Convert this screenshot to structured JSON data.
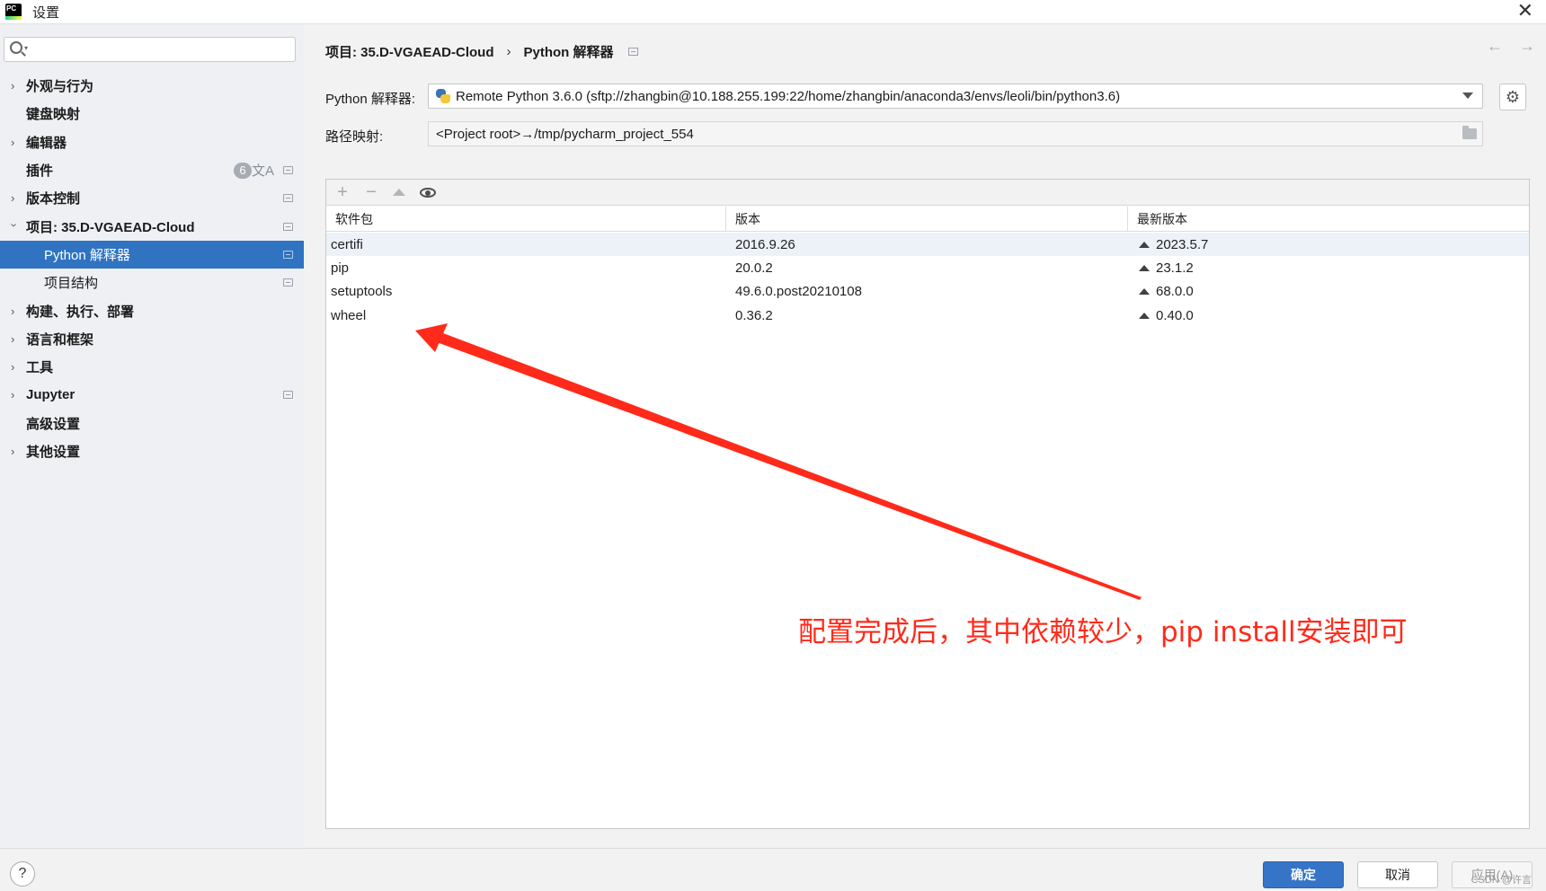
{
  "window": {
    "title": "设置",
    "app_icon_text": "PC"
  },
  "sidebar": {
    "search_placeholder": "",
    "items": [
      {
        "label": "外观与行为",
        "expandable": true
      },
      {
        "label": "键盘映射",
        "expandable": false
      },
      {
        "label": "编辑器",
        "expandable": true
      },
      {
        "label": "插件",
        "expandable": false,
        "badge": "6"
      },
      {
        "label": "版本控制",
        "expandable": true
      },
      {
        "label": "项目: 35.D-VGAEAD-Cloud",
        "expandable": true,
        "expanded": true
      },
      {
        "label": "Python 解释器",
        "sub": true,
        "selected": true
      },
      {
        "label": "项目结构",
        "sub": true
      },
      {
        "label": "构建、执行、部署",
        "expandable": true
      },
      {
        "label": "语言和框架",
        "expandable": true
      },
      {
        "label": "工具",
        "expandable": true
      },
      {
        "label": "Jupyter",
        "expandable": true
      },
      {
        "label": "高级设置",
        "expandable": false
      },
      {
        "label": "其他设置",
        "expandable": true
      }
    ]
  },
  "breadcrumb": {
    "project": "项目: 35.D-VGAEAD-Cloud",
    "separator": "›",
    "page": "Python 解释器"
  },
  "interpreter": {
    "label": "Python 解释器:",
    "value": "Remote Python 3.6.0 (sftp://zhangbin@10.188.255.199:22/home/zhangbin/anaconda3/envs/leoli/bin/python3.6)"
  },
  "path_mapping": {
    "label": "路径映射:",
    "value": "<Project root>→/tmp/pycharm_project_554"
  },
  "packages": {
    "headers": [
      "软件包",
      "版本",
      "最新版本"
    ],
    "rows": [
      {
        "name": "certifi",
        "version": "2016.9.26",
        "latest": "2023.5.7"
      },
      {
        "name": "pip",
        "version": "20.0.2",
        "latest": "23.1.2"
      },
      {
        "name": "setuptools",
        "version": "49.6.0.post20210108",
        "latest": "68.0.0"
      },
      {
        "name": "wheel",
        "version": "0.36.2",
        "latest": "0.40.0"
      }
    ]
  },
  "annotation": {
    "text": "配置完成后，其中依赖较少，pip install安装即可",
    "color": "#ff2a1a"
  },
  "footer": {
    "help": "?",
    "ok": "确定",
    "cancel": "取消",
    "apply": "应用(A)",
    "watermark": "CSDN @许言"
  },
  "colors": {
    "accent": "#2f73c1",
    "ok_button": "#3574c6"
  }
}
